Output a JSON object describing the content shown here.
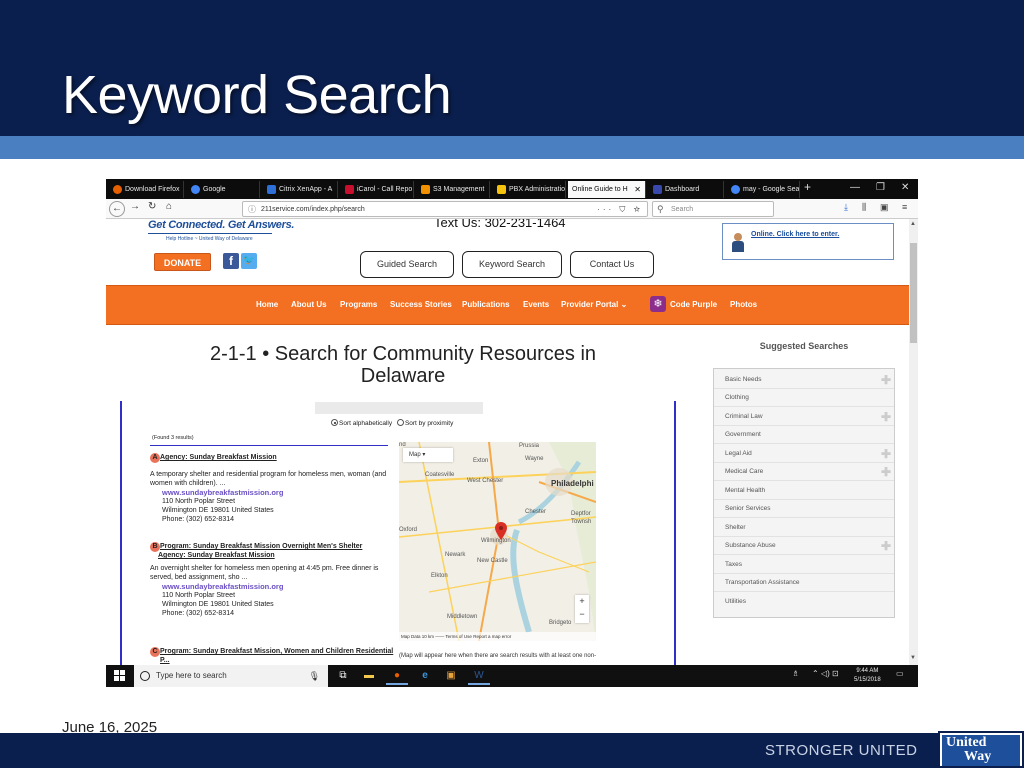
{
  "slide": {
    "title": "Keyword Search",
    "date": "June 16, 2025",
    "tagline": "STRONGER UNITED",
    "logo_line1": "United",
    "logo_line2": "Way"
  },
  "browser": {
    "tabs": [
      {
        "label": "Download Firefox",
        "color": "#e66000"
      },
      {
        "label": "Google",
        "color": "#4285f4"
      },
      {
        "label": "Citrix XenApp - A",
        "color": "#2e6fd8"
      },
      {
        "label": "iCarol - Call Repo",
        "color": "#c8102e"
      },
      {
        "label": "S3 Management",
        "color": "#f29100"
      },
      {
        "label": "PBX Administratio",
        "color": "#f4c20d"
      },
      {
        "label": "Online Guide to H",
        "color": "#f9f9fa"
      },
      {
        "label": "Dashboard",
        "color": "#3949ab"
      },
      {
        "label": "may - Google Sea",
        "color": "#4285f4"
      }
    ],
    "url": "211service.com/index.php/search",
    "search_placeholder": "Search"
  },
  "site": {
    "slogan": "Get Connected. Get Answers.",
    "hotline": "Help Hotline ~ United Way of Delaware",
    "text_us": "Text Us: 302-231-1464",
    "donate": "DONATE",
    "pills": [
      "Guided Search",
      "Keyword Search",
      "Contact Us"
    ],
    "online_link": "Online. Click here to enter.",
    "nav": [
      "Home",
      "About Us",
      "Programs",
      "Success Stories",
      "Publications",
      "Events",
      "Provider Portal ⌄",
      "Code Purple",
      "Photos"
    ],
    "heading": "2-1-1 • Search for Community Resources in Delaware",
    "suggested_title": "Suggested Searches",
    "suggested": [
      {
        "label": "Basic Needs",
        "plus": true
      },
      {
        "label": "Clothing",
        "plus": false
      },
      {
        "label": "Criminal Law",
        "plus": true
      },
      {
        "label": "Government",
        "plus": false
      },
      {
        "label": "Legal Aid",
        "plus": true
      },
      {
        "label": "Medical Care",
        "plus": true
      },
      {
        "label": "Mental Health",
        "plus": false
      },
      {
        "label": "Senior Services",
        "plus": false
      },
      {
        "label": "Shelter",
        "plus": false
      },
      {
        "label": "Substance Abuse",
        "plus": true
      },
      {
        "label": "Taxes",
        "plus": false
      },
      {
        "label": "Transportation Assistance",
        "plus": false
      },
      {
        "label": "Utilities",
        "plus": false
      }
    ]
  },
  "results": {
    "sort_alpha": "Sort alphabetically",
    "sort_prox": "Sort by proximity",
    "found": "(Found 3 results)",
    "r1": {
      "letter": "A",
      "head": "Agency: Sunday Breakfast Mission",
      "desc": "A temporary shelter and residential program for homeless men, woman (and women with children). ...",
      "web": "www.sundaybreakfastmission.org",
      "addr1": "110 North Poplar Street",
      "addr2": "Wilmington DE 19801 United States",
      "phone": "Phone: (302) 652-8314"
    },
    "r2": {
      "letter": "B",
      "head1": "Program: Sunday Breakfast Mission Overnight Men's Shelter",
      "head2": "Agency: Sunday Breakfast Mission",
      "desc": "An overnight shelter for homeless men opening at 4:45 pm. Free dinner is served, bed assignment, sho ...",
      "web": "www.sundaybreakfastmission.org",
      "addr1": "110 North Poplar Street",
      "addr2": "Wilmington DE 19801 United States",
      "phone": "Phone: (302) 652-8314"
    },
    "r3": {
      "letter": "C",
      "head": "Program: Sunday Breakfast Mission, Women and Children Residential P..."
    },
    "map": {
      "type_btn": "Map",
      "labels": [
        "Prussia",
        "Wayne",
        "Exton",
        "West Chester",
        "Philadelphi",
        "Coatesville",
        "Chester",
        "Deptfor",
        "Townsh",
        "Oxford",
        "Wilmington",
        "Newark",
        "New Castle",
        "Elkton",
        "Middletown",
        "Bridgeto",
        "nd"
      ],
      "footer": "Map Data  10 km ——  Terms of Use  Report a map error",
      "note": "(Map will appear here when there are search results with at least one non-"
    }
  },
  "taskbar": {
    "search": "Type here to search",
    "time": "9:44 AM",
    "date": "5/15/2018"
  }
}
